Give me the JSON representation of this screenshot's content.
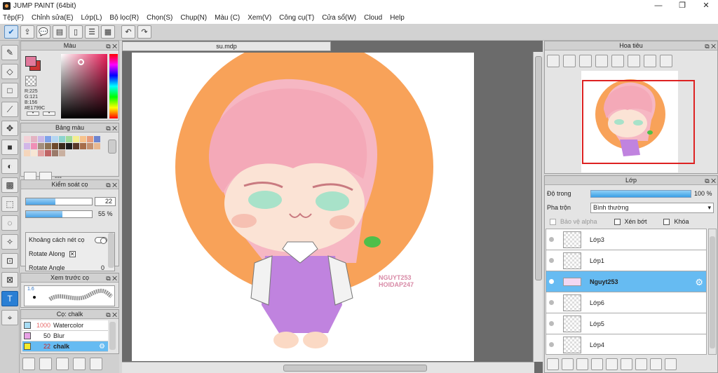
{
  "window": {
    "title": "JUMP PAINT (64bit)",
    "controls": [
      "—",
      "❐",
      "✕"
    ]
  },
  "menu": [
    "Tệp(F)",
    "Chỉnh sửa(E)",
    "Lớp(L)",
    "Bộ lọc(R)",
    "Chọn(S)",
    "Chụp(N)",
    "Màu (C)",
    "Xem(V)",
    "Công cụ(T)",
    "Cửa sổ(W)",
    "Cloud",
    "Help"
  ],
  "color_panel": {
    "title": "Màu",
    "rgb_r": "R:225",
    "rgb_g": "G:121",
    "rgb_b": "B:156",
    "hex": "#E1799C",
    "main_color": "#e1799c"
  },
  "palette_panel": {
    "title": "Bảng màu",
    "label": "---",
    "colors": [
      "#f3d1d7",
      "#e4b3c2",
      "#cbb7e7",
      "#7fa3ea",
      "#b5d6f2",
      "#8dd4cf",
      "#a0dc9b",
      "#f4ee8f",
      "#f7c28c",
      "#e79b7c",
      "#6e84cf",
      "#d2b6e8",
      "#ef8fb6",
      "#a38f7e",
      "#8c7355",
      "#6e4a2d",
      "#3a2a1c",
      "#1d1d1d",
      "#5b3a2a",
      "#a76d4a",
      "#c49070",
      "#e7b892",
      "#f5d6bc",
      "#f7e6d4",
      "#e2a0a0",
      "#c06565",
      "#9b7a6a",
      "#c9b0a0"
    ]
  },
  "brush_control": {
    "title": "Kiểm soát cọ",
    "size_value": "22",
    "size_fraction": 0.45,
    "opacity_value": "55 %",
    "opacity_fraction": 0.55,
    "option_spacing": "Khoảng cách nét cọ",
    "option_rotate_along": "Rotate Along",
    "option_rotate_angle": "Rotate Angle",
    "rotate_angle_value": "0"
  },
  "brush_preview": {
    "title": "Xem trước cọ",
    "size_label": "1.6"
  },
  "brush_list": {
    "title": "Cọ: chalk",
    "items": [
      {
        "color": "#a7dcf4",
        "size": "1000",
        "name": "Watercolor"
      },
      {
        "color": "#e8a2e6",
        "size": "50",
        "name": "Blur"
      },
      {
        "color": "#f2ea2a",
        "size": "22",
        "name": "chalk"
      }
    ]
  },
  "document": {
    "tab": "su.mdp",
    "watermark_line1": "NGUYT253",
    "watermark_line2": "HOIDAP247"
  },
  "navigator": {
    "title": "Hoa tiêu"
  },
  "layers_panel": {
    "title": "Lớp",
    "opacity_label": "Độ trong",
    "opacity_value": "100 %",
    "blend_label": "Pha trộn",
    "blend_value": "Bình thường",
    "protect_alpha": "Bảo vệ alpha",
    "clipping": "Xén bớt",
    "lock": "Khóa",
    "layers": [
      {
        "name": "Lớp3"
      },
      {
        "name": "Lớp1"
      },
      {
        "name": "Nguyt253"
      },
      {
        "name": "Lớp6"
      },
      {
        "name": "Lớp5"
      },
      {
        "name": "Lớp4"
      }
    ]
  },
  "colors": {
    "accent_blue": "#66bbf2",
    "active_tool": "#2a7fd4",
    "canvas_orange": "#f8a259"
  }
}
